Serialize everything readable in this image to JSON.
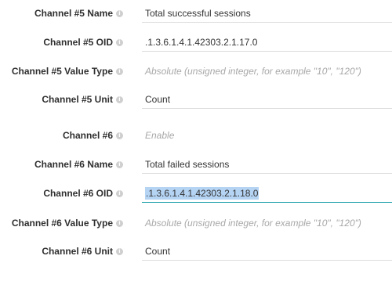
{
  "rows": [
    {
      "label": "Channel #5 Name",
      "value": "Total successful sessions",
      "placeholder": ""
    },
    {
      "label": "Channel #5 OID",
      "value": ".1.3.6.1.4.1.42303.2.1.17.0",
      "placeholder": ""
    },
    {
      "label": "Channel #5 Value Type",
      "value": "",
      "placeholder": "Absolute (unsigned integer, for example \"10\", \"120\")"
    },
    {
      "label": "Channel #5 Unit",
      "value": "Count",
      "placeholder": ""
    },
    {
      "label": "Channel #6",
      "value": "",
      "placeholder": "Enable"
    },
    {
      "label": "Channel #6 Name",
      "value": "Total failed sessions",
      "placeholder": ""
    },
    {
      "label": "Channel #6 OID",
      "value": ".1.3.6.1.4.1.42303.2.1.18.0",
      "placeholder": ""
    },
    {
      "label": "Channel #6 Value Type",
      "value": "",
      "placeholder": "Absolute (unsigned integer, for example \"10\", \"120\")"
    },
    {
      "label": "Channel #6 Unit",
      "value": "Count",
      "placeholder": ""
    }
  ],
  "info_glyph": "i",
  "colors": {
    "accent_underline": "#1aa0a8",
    "selection": "#b5d4f4",
    "placeholder": "#a8a8a8"
  }
}
